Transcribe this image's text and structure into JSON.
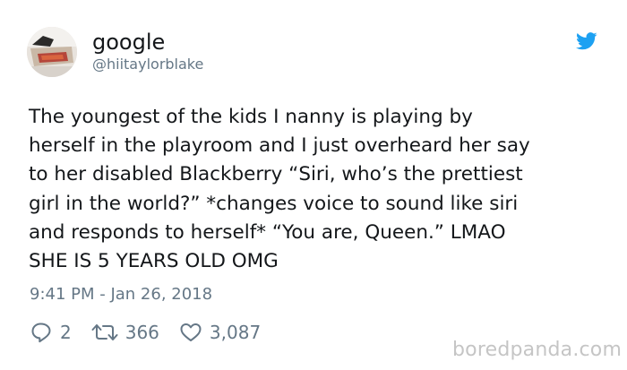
{
  "user": {
    "display_name": "google",
    "handle": "@hiitaylorblake"
  },
  "tweet": {
    "text": "The youngest of the kids I nanny is playing by\nherself in the playroom and I just overheard her say\nto her disabled Blackberry “Siri, who’s the prettiest\ngirl in the world?” *changes voice to sound like siri\nand responds to herself* “You are, Queen.” LMAO\nSHE IS 5 YEARS OLD OMG",
    "timestamp": "9:41 PM - Jan 26, 2018"
  },
  "actions": {
    "reply_count": "2",
    "retweet_count": "366",
    "like_count": "3,087"
  },
  "watermark": "boredpanda.com",
  "icons": {
    "brand": "twitter-bird-icon",
    "reply": "reply-icon",
    "retweet": "retweet-icon",
    "like": "heart-icon"
  },
  "colors": {
    "text": "#14171a",
    "secondary": "#657786",
    "twitter_blue": "#1da1f2",
    "watermark": "#c5c5c5"
  }
}
